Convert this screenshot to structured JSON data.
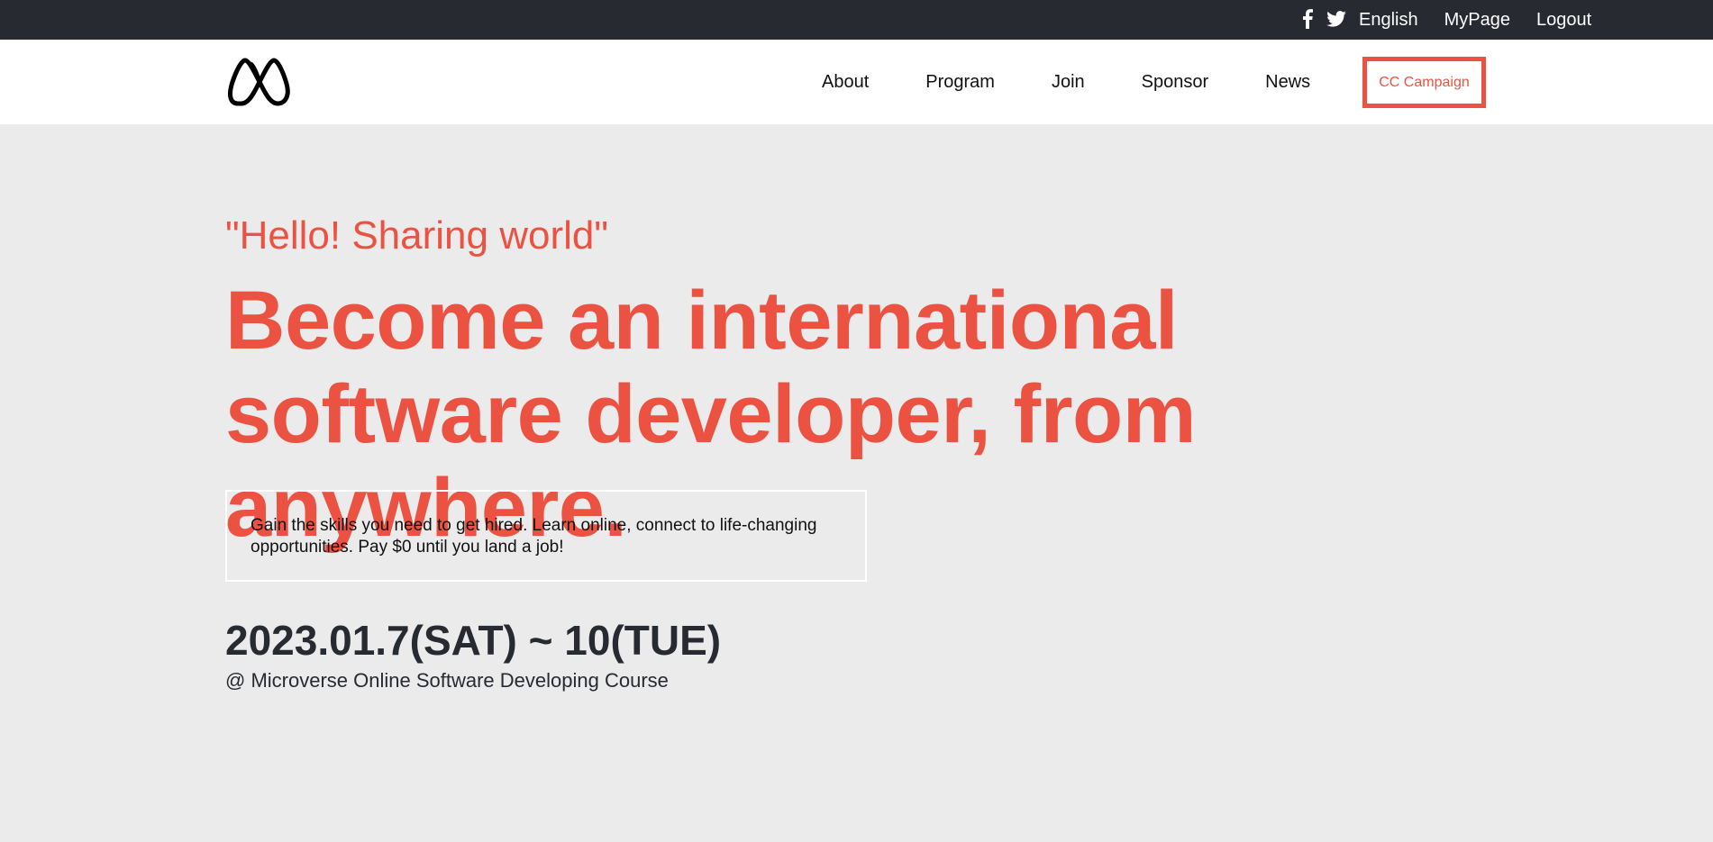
{
  "topbar": {
    "social_icons": [
      "facebook-icon",
      "twitter-icon"
    ],
    "links": [
      "English",
      "MyPage",
      "Logout"
    ]
  },
  "navbar": {
    "logo_icon": "microverse-logo",
    "menu": [
      "About",
      "Program",
      "Join",
      "Sponsor",
      "News"
    ],
    "cta_label": "CC Campaign"
  },
  "hero": {
    "tagline": "\"Hello! Sharing world\"",
    "headline": "Become an international software developer, from anywhere.",
    "description": "Gain the skills you need to get hired. Learn online, connect to life-changing opportunities. Pay $0 until you land a job!",
    "date": "2023.01.7(SAT) ~ 10(TUE)",
    "venue": "@ Microverse Online Software Developing Course"
  },
  "colors": {
    "accent": "#ec5242",
    "dark": "#272a31",
    "background": "#ebebeb"
  }
}
